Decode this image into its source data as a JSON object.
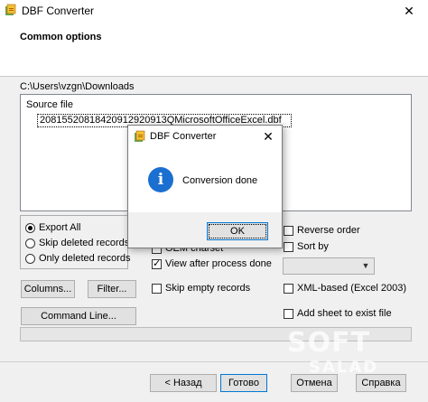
{
  "window": {
    "title": "DBF Converter",
    "close_glyph": "✕",
    "icon": "dbf-converter-icon"
  },
  "header": {
    "section_title": "Common options"
  },
  "path": "C:\\Users\\vzgn\\Downloads",
  "file_list": {
    "header": "Source file",
    "items": [
      "20815520818420912920913QMicrosoftOfficeExcel.dbf"
    ]
  },
  "export_mode": {
    "options": [
      "Export All",
      "Skip deleted records",
      "Only deleted records"
    ],
    "selected": 0
  },
  "left_options": {
    "oem_charset": "OEM charset",
    "view_after": "View after process done",
    "skip_empty": "Skip empty records"
  },
  "right_options": {
    "reverse_order": "Reverse order",
    "sort_by": "Sort by",
    "xml_based": "XML-based (Excel 2003)",
    "add_sheet": "Add sheet to exist file"
  },
  "buttons": {
    "columns": "Columns...",
    "filter": "Filter...",
    "command_line": "Command Line...",
    "back": "< Назад",
    "done": "Готово",
    "cancel": "Отмена",
    "help": "Справка"
  },
  "dialog": {
    "title": "DBF Converter",
    "message": "Conversion done",
    "ok": "OK",
    "close_glyph": "✕",
    "info_glyph": "i"
  },
  "watermark": {
    "line1": "SOFT",
    "line2": "SALAD"
  },
  "colors": {
    "accent": "#0078d7",
    "info_icon": "#1a6fd1"
  }
}
